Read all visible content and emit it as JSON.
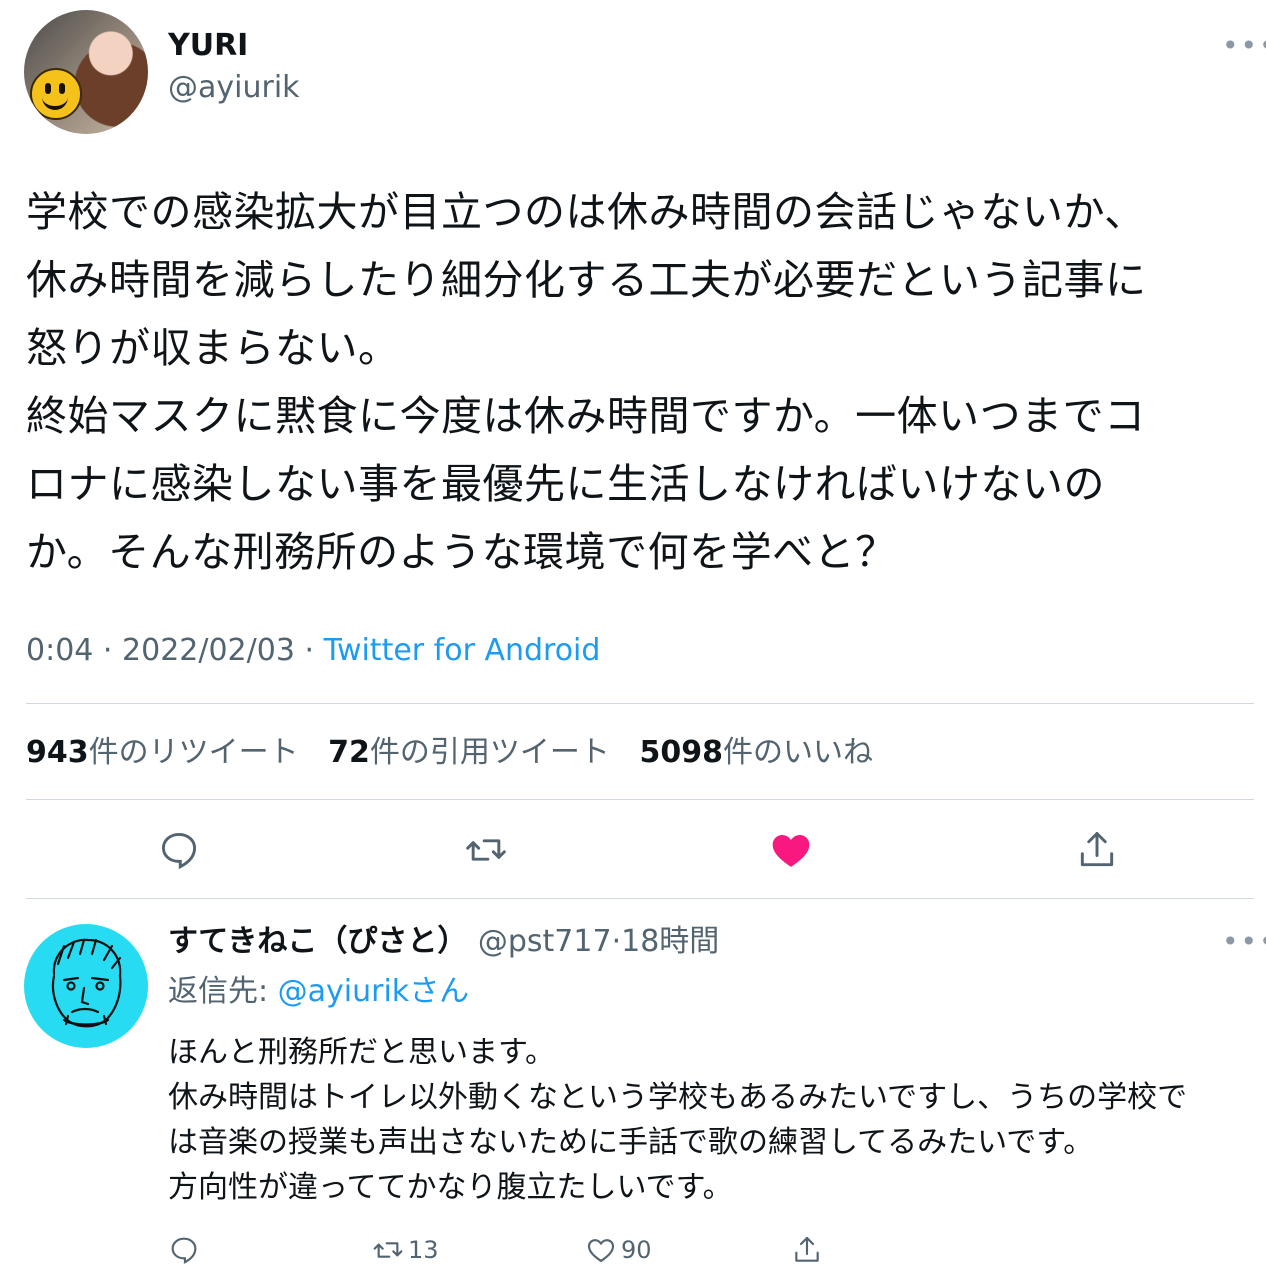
{
  "tweet": {
    "display_name": "YURI",
    "handle": "@ayiurik",
    "more_icon": "more-horizontal-icon",
    "text": "学校での感染拡大が目立つのは休み時間の会話じゃないか、\n休み時間を減らしたり細分化する工夫が必要だという記事に\n怒りが収まらない。\n終始マスクに黙食に今度は休み時間ですか。一体いつまでコ\nロナに感染しない事を最優先に生活しなければいけないの\nか。そんな刑務所のような環境で何を学べと？",
    "time": "0:04",
    "date": "2022/02/03",
    "separator": "·",
    "source": "Twitter for Android",
    "stats": {
      "retweets": "943",
      "retweets_label": "件のリツイート",
      "quotes": "72",
      "quotes_label": "件の引用ツイート",
      "likes": "5098",
      "likes_label": "件のいいね"
    },
    "actions": {
      "reply_icon": "reply-icon",
      "retweet_icon": "retweet-icon",
      "like_icon": "heart-filled-icon",
      "share_icon": "share-icon",
      "like_color": "#f91880"
    }
  },
  "reply": {
    "display_name": "すてきねこ（ぴさと）",
    "handle": "@pst717",
    "separator": "·",
    "time_ago": "18時間",
    "reply_to_label": "返信先: ",
    "reply_to_handle": "@ayiurik",
    "reply_to_suffix": "さん",
    "text": "ほんと刑務所だと思います。\n休み時間はトイレ以外動くなという学校もあるみたいですし、うちの学校で\nは音楽の授業も声出さないために手話で歌の練習してるみたいです。\n方向性が違っててかなり腹立たしいです。",
    "retweet_count": "13",
    "like_count": "90"
  },
  "colors": {
    "text": "#0f1419",
    "secondary": "#536471",
    "link": "#1d9bf0",
    "divider": "#cfd9de",
    "reply_avatar_bg": "#27dcf2"
  }
}
